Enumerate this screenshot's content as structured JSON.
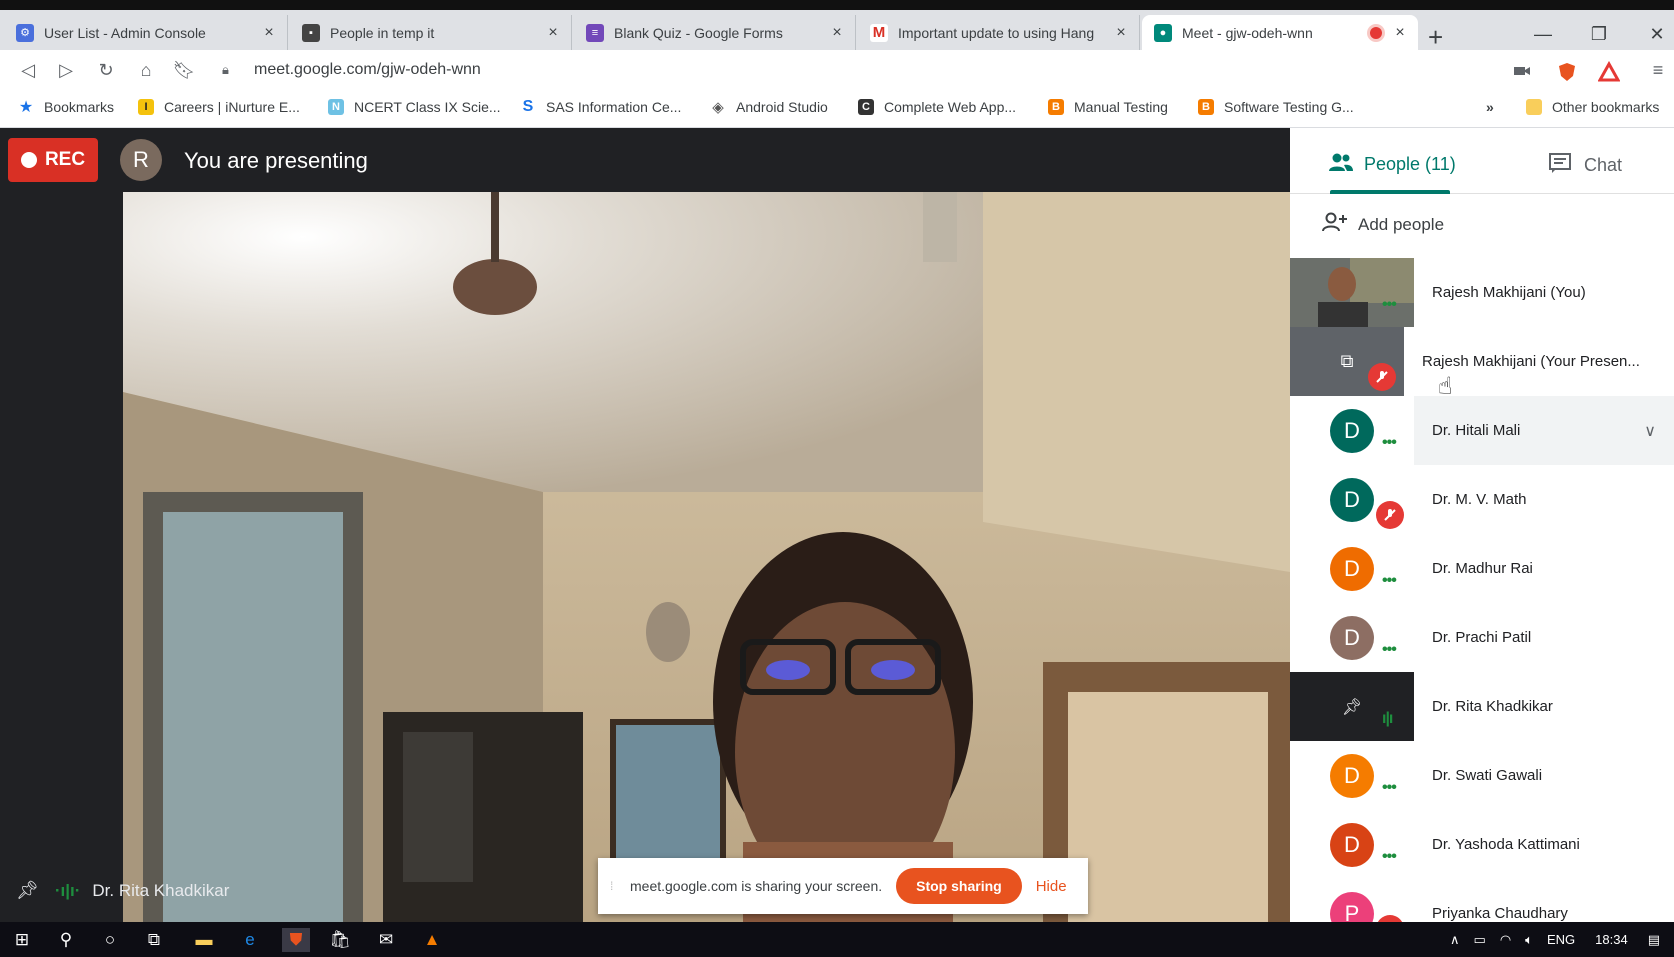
{
  "browser": {
    "tabs": [
      {
        "title": "User List - Admin Console",
        "icon": "admin-console-icon",
        "color": "#4a6fdc"
      },
      {
        "title": "People in temp it",
        "icon": "contacts-icon",
        "color": "#444"
      },
      {
        "title": "Blank Quiz - Google Forms",
        "icon": "google-forms-icon",
        "color": "#7248b9"
      },
      {
        "title": "Important update to using Hang",
        "icon": "gmail-icon",
        "color": "#d93025"
      },
      {
        "title": "Meet - gjw-odeh-wnn",
        "icon": "google-meet-icon",
        "color": "#00897b"
      }
    ],
    "url": "meet.google.com/gjw-odeh-wnn",
    "bookmarks": [
      {
        "label": "Bookmarks",
        "icon": "star-icon"
      },
      {
        "label": "Careers | iNurture E...",
        "icon": "inurture-icon"
      },
      {
        "label": "NCERT Class IX Scie...",
        "icon": "ncert-icon"
      },
      {
        "label": "SAS Information Ce...",
        "icon": "sas-icon"
      },
      {
        "label": "Android Studio",
        "icon": "android-studio-icon"
      },
      {
        "label": "Complete Web App...",
        "icon": "web-app-icon"
      },
      {
        "label": "Manual Testing",
        "icon": "blogger-icon"
      },
      {
        "label": "Software Testing G...",
        "icon": "blogger-icon"
      }
    ],
    "more_bookmarks": "»",
    "other_bookmarks": "Other bookmarks"
  },
  "meet": {
    "rec_label": "REC",
    "avatar_letter": "R",
    "presenting_text": "You are presenting",
    "active_speaker": "Dr. Rita Khadkikar",
    "share_message": "meet.google.com is sharing your screen.",
    "stop_sharing": "Stop sharing",
    "hide": "Hide"
  },
  "panel": {
    "people_tab": "People (11)",
    "chat_tab": "Chat",
    "add_people": "Add people",
    "participants": [
      {
        "name": "Rajesh Makhijani (You)",
        "type": "video"
      },
      {
        "name": "Rajesh Makhijani (Your Presen...",
        "type": "presentation"
      },
      {
        "name": "Dr. Hitali Mali",
        "letter": "D",
        "color": "#00695c",
        "status": "talking"
      },
      {
        "name": "Dr. M. V. Math",
        "letter": "D",
        "color": "#00695c",
        "status": "muted"
      },
      {
        "name": "Dr. Madhur Rai",
        "letter": "D",
        "color": "#ef6c00",
        "status": "talking"
      },
      {
        "name": "Dr. Prachi Patil",
        "letter": "D",
        "color": "#8d6e63",
        "status": "talking"
      },
      {
        "name": "Dr. Rita Khadkikar",
        "type": "pinned",
        "status": "speaking"
      },
      {
        "name": "Dr. Swati Gawali",
        "letter": "D",
        "color": "#f57c00",
        "status": "talking"
      },
      {
        "name": "Dr. Yashoda Kattimani",
        "letter": "D",
        "color": "#d84315",
        "status": "talking"
      },
      {
        "name": "Priyanka Chaudhary",
        "letter": "P",
        "color": "#ec407a",
        "status": "muted"
      }
    ]
  },
  "taskbar": {
    "language": "ENG",
    "time": "18:34"
  }
}
